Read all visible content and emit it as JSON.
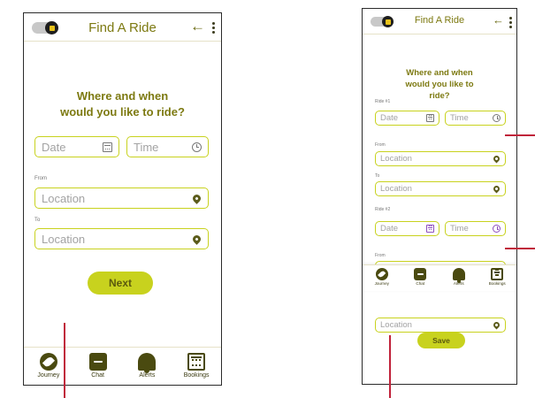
{
  "screen_one": {
    "app_title": "Find A Ride",
    "heading": "Where and when would you like to ride?",
    "date_placeholder": "Date",
    "time_placeholder": "Time",
    "from_label": "From",
    "from_placeholder": "Location",
    "to_label": "To",
    "to_placeholder": "Location",
    "next_label": "Next",
    "nav": [
      {
        "label": "Journey",
        "icon": "journey-icon"
      },
      {
        "label": "Chat",
        "icon": "chat-icon"
      },
      {
        "label": "Alerts",
        "icon": "bell-icon"
      },
      {
        "label": "Bookings",
        "icon": "calendar-icon"
      }
    ]
  },
  "screen_two": {
    "app_title": "Find A Ride",
    "heading": "Where and when would you like to ride?",
    "ride1_label": "Ride #1",
    "ride1_date": "Date",
    "ride1_time": "Time",
    "ride1_from_label": "From",
    "ride1_from": "Location",
    "ride1_to_label": "To",
    "ride1_to": "Location",
    "ride2_label": "Ride #2",
    "ride2_date": "Date",
    "ride2_time": "Time",
    "ride2_from_label": "From",
    "ride2_to": "Location",
    "save_label": "Save",
    "nav": [
      {
        "label": "Journey",
        "icon": "journey-icon"
      },
      {
        "label": "Chat",
        "icon": "chat-icon"
      },
      {
        "label": "Alerts",
        "icon": "bell-icon"
      },
      {
        "label": "Bookings",
        "icon": "calendar-icon"
      }
    ]
  },
  "colors": {
    "accent": "#c8d21e",
    "title_olive": "#7d7a12",
    "icon_dark": "#4a4a10",
    "highlight_purple": "#8e4fbf",
    "annotation_red": "#c0223a"
  }
}
